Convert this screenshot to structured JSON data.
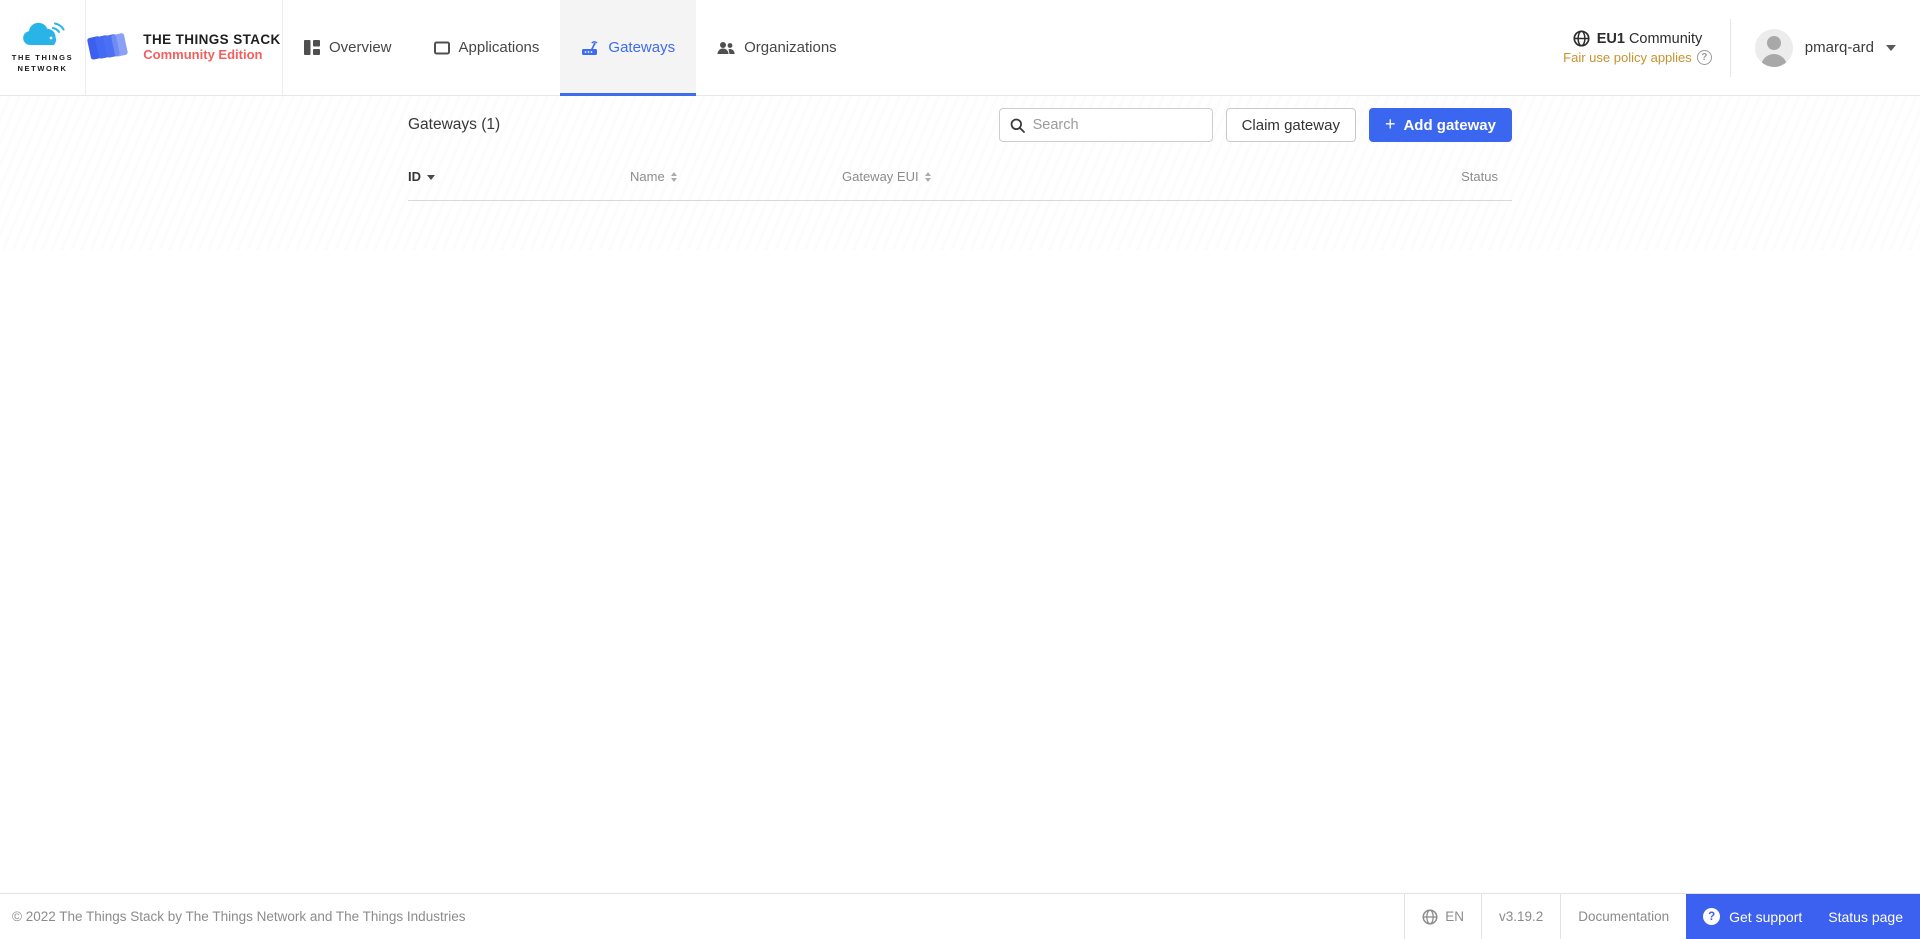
{
  "header": {
    "ttn_logo": {
      "line1": "THE THINGS",
      "line2": "NETWORK"
    },
    "tts_logo": {
      "title": "THE THINGS STACK",
      "subtitle": "Community Edition"
    },
    "tabs": [
      {
        "label": "Overview",
        "icon": "dashboard-icon",
        "active": false
      },
      {
        "label": "Applications",
        "icon": "applications-icon",
        "active": false
      },
      {
        "label": "Gateways",
        "icon": "gateway-icon",
        "active": true
      },
      {
        "label": "Organizations",
        "icon": "organizations-icon",
        "active": false
      }
    ],
    "cluster": {
      "id": "EU1",
      "name": "Community",
      "notice": "Fair use policy applies",
      "question_glyph": "?"
    },
    "user": {
      "name": "pmarq-ard"
    }
  },
  "toolbar": {
    "title": "Gateways (1)",
    "search_placeholder": "Search",
    "claim_label": "Claim gateway",
    "add_plus": "+",
    "add_label": "Add gateway"
  },
  "table": {
    "columns": [
      {
        "label": "ID",
        "sort": "desc"
      },
      {
        "label": "Name",
        "sort": "both"
      },
      {
        "label": "Gateway EUI",
        "sort": "both"
      },
      {
        "label": "Status",
        "sort": "none"
      }
    ],
    "rows": []
  },
  "footer": {
    "copyright": "© 2022 The Things Stack by The Things Network and The Things Industries",
    "language": "EN",
    "version": "v3.19.2",
    "documentation": "Documentation",
    "get_support": "Get support",
    "status_page": "Status page",
    "question_glyph": "?"
  },
  "colors": {
    "primary_blue": "#3b66f0",
    "footer_blue": "#3c60ef",
    "active_tab_blue": "#3d6cf0",
    "ttn_cloud_blue": "#29b4e8",
    "community_red": "#f25f5f",
    "fair_use_orange": "#c8922f"
  }
}
